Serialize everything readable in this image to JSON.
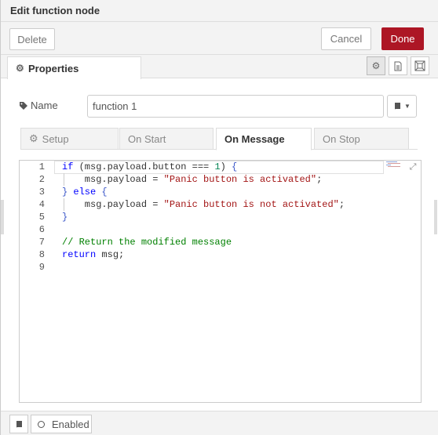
{
  "header": {
    "title": "Edit function node"
  },
  "toolbar": {
    "delete_label": "Delete",
    "cancel_label": "Cancel",
    "done_label": "Done"
  },
  "properties_tab": {
    "label": "Properties",
    "icon": "gear-icon"
  },
  "tray_icons": [
    "gear-icon",
    "document-icon",
    "layout-icon"
  ],
  "name_field": {
    "label": "Name",
    "icon": "tag-icon",
    "value": "function 1"
  },
  "subtabs": [
    {
      "label": "Setup",
      "icon": "gear-icon",
      "active": false
    },
    {
      "label": "On Start",
      "active": false
    },
    {
      "label": "On Message",
      "active": true
    },
    {
      "label": "On Stop",
      "active": false
    }
  ],
  "editor": {
    "line_numbers": [
      "1",
      "2",
      "3",
      "4",
      "5",
      "6",
      "7",
      "8",
      "9"
    ],
    "lines": [
      "if (msg.payload.button === 1) {",
      "    msg.payload = \"Panic button is activated\";",
      "} else {",
      "    msg.payload = \"Panic button is not activated\";",
      "}",
      "",
      "// Return the modified message",
      "return msg;",
      ""
    ]
  },
  "footer": {
    "enabled_label": "Enabled",
    "book_icon": "book-icon"
  },
  "colors": {
    "done_button": "#ad1625",
    "keyword": "#0000ff",
    "string": "#a31515",
    "comment": "#008000",
    "number": "#098658"
  }
}
